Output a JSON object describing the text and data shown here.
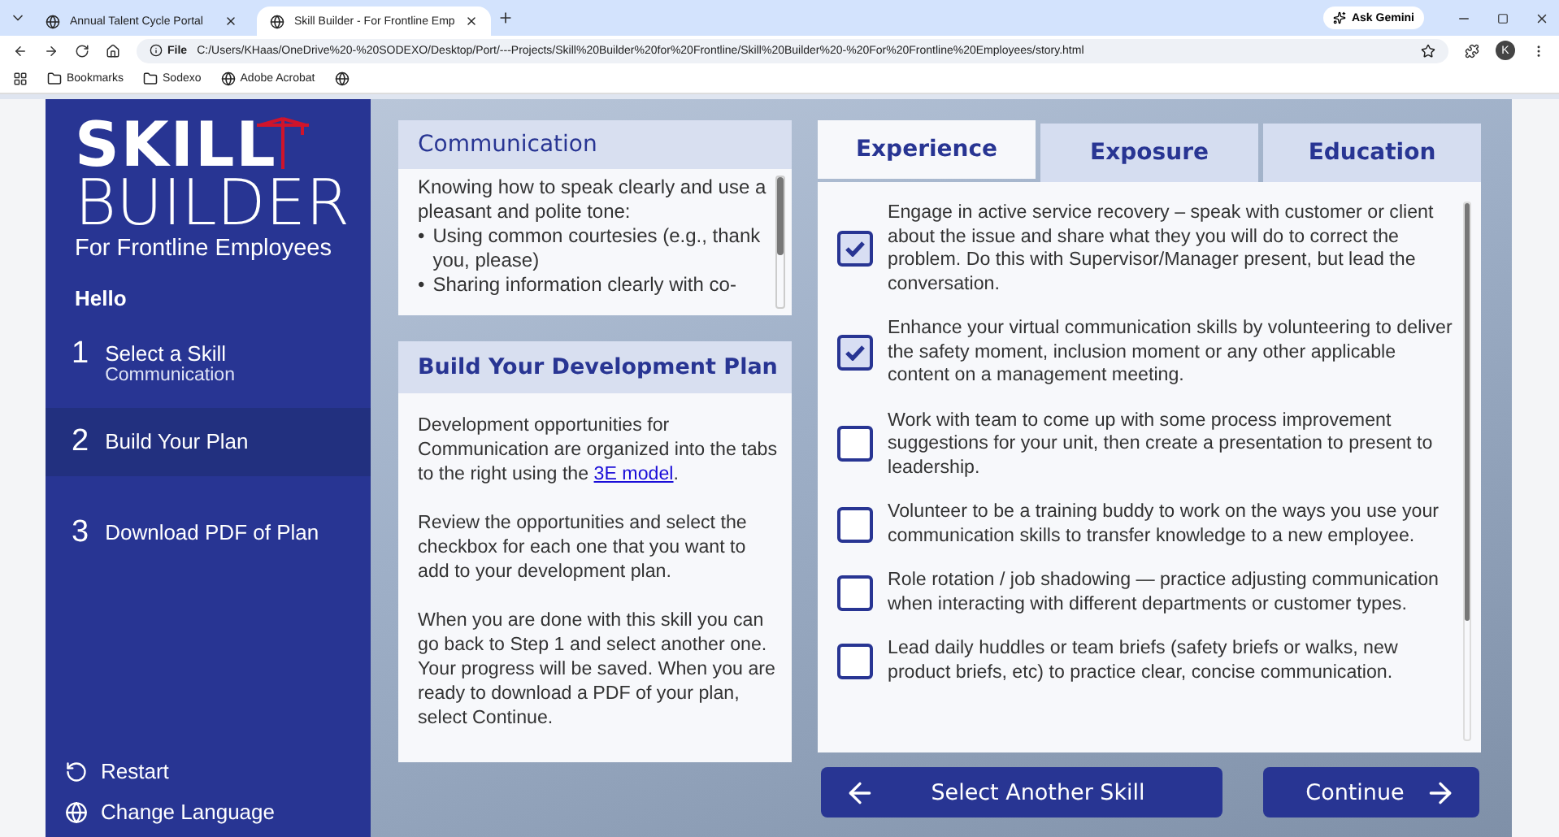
{
  "browser": {
    "tabs": [
      {
        "title": "Annual Talent Cycle Portal",
        "selected": false
      },
      {
        "title": "Skill Builder - For Frontline Emp",
        "selected": true
      }
    ],
    "ask_button": "Ask Gemini",
    "address": {
      "scheme": "File",
      "url": "C:/Users/KHaas/OneDrive%20-%20SODEXO/Desktop/Port/---Projects/Skill%20Builder%20for%20Frontline/Skill%20Builder%20-%20For%20Frontline%20Employees/story.html"
    },
    "profile": "K",
    "bookmarks": [
      {
        "label": "Bookmarks",
        "kind": "folder"
      },
      {
        "label": "Sodexo",
        "kind": "folder"
      },
      {
        "label": "Adobe Acrobat",
        "kind": "site"
      },
      {
        "kind": "site"
      }
    ]
  },
  "sidebar": {
    "logo": {
      "line_1": "SKILL",
      "line_2": "BUILDER",
      "line_3": "For Frontline Employees"
    },
    "greeting": "Hello",
    "steps": [
      {
        "number": "1",
        "label": "Select a Skill",
        "sublabel": "Communication",
        "selected": false
      },
      {
        "number": "2",
        "label": "Build Your Plan",
        "selected": true
      },
      {
        "number": "3",
        "label": "Download PDF of Plan",
        "selected": false
      }
    ],
    "links": [
      {
        "label": "Restart",
        "kind": "restart"
      },
      {
        "label": "Change Language",
        "kind": "language"
      }
    ]
  },
  "skill_card": {
    "title": "Communication",
    "intro": "Knowing how to speak clearly and use a pleasant and polite tone:",
    "bullet": "•",
    "bullets": [
      "Using common courtesies (e.g., thank you, please)",
      "Sharing information clearly with co-"
    ]
  },
  "plan_card": {
    "title": "Build Your Development Plan",
    "paragraphs": [
      {
        "text": "Development opportunities for Communication are organized into the tabs to the right using the ",
        "link": "3E model",
        "after": "."
      },
      {
        "text": "Review the opportunities and select the checkbox for each one that you want to add to your development plan."
      },
      {
        "text": "When you are done with this skill you can go back to Step 1 and select another one. Your progress will be saved. When you are ready to download a PDF of your plan, select Continue."
      }
    ]
  },
  "tabs": [
    {
      "label": "Experience",
      "selected": true
    },
    {
      "label": "Exposure",
      "selected": false
    },
    {
      "label": "Education",
      "selected": false
    }
  ],
  "opportunities": [
    {
      "text": "Engage in active service recovery – speak with customer or client about the issue and share what they you will do to correct the problem.  Do this with Supervisor/Manager present, but lead the conversation.",
      "checked": true
    },
    {
      "text": "Enhance your virtual communication skills by volunteering to deliver the safety moment, inclusion moment or any other applicable content on a management meeting.",
      "checked": true
    },
    {
      "text": "Work with team to come up with some process improvement suggestions for your unit, then create a presentation to present to leadership.",
      "checked": false
    },
    {
      "text": "Volunteer to be a training buddy to work on the ways you use your communication skills to transfer knowledge to a new employee.",
      "checked": false
    },
    {
      "text": "Role rotation / job shadowing — practice adjusting communication when interacting with different departments or customer types.",
      "checked": false
    },
    {
      "text": "Lead daily huddles or team briefs (safety briefs or walks, new product briefs, etc) to practice clear, concise communication.",
      "checked": false
    }
  ],
  "buttons": [
    {
      "label": "Select Another Skill",
      "kind": "back"
    },
    {
      "label": "Continue",
      "kind": "next"
    }
  ]
}
